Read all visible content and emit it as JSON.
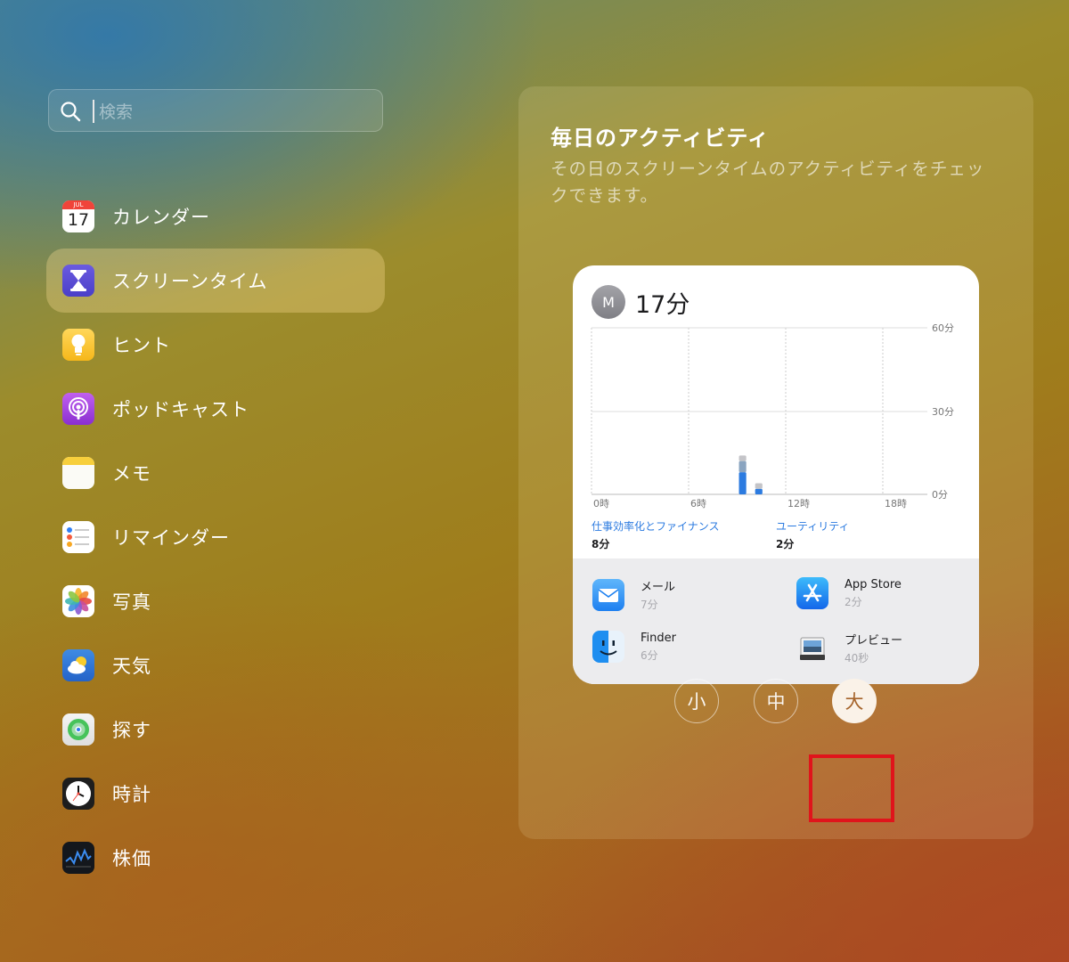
{
  "search": {
    "placeholder": "検索"
  },
  "sidebar": {
    "items": [
      {
        "label": "カレンダー",
        "icon": "calendar-icon",
        "month": "JUL",
        "day": "17"
      },
      {
        "label": "スクリーンタイム",
        "icon": "hourglass-icon",
        "selected": true
      },
      {
        "label": "ヒント",
        "icon": "lightbulb-icon"
      },
      {
        "label": "ポッドキャスト",
        "icon": "podcast-icon"
      },
      {
        "label": "メモ",
        "icon": "notes-icon"
      },
      {
        "label": "リマインダー",
        "icon": "reminders-icon"
      },
      {
        "label": "写真",
        "icon": "photos-icon"
      },
      {
        "label": "天気",
        "icon": "weather-icon"
      },
      {
        "label": "探す",
        "icon": "find-my-icon"
      },
      {
        "label": "時計",
        "icon": "clock-icon"
      },
      {
        "label": "株価",
        "icon": "stocks-icon"
      }
    ]
  },
  "panel": {
    "title": "毎日のアクティビティ",
    "description": "その日のスクリーンタイムのアクティビティをチェックできます。",
    "sizes": [
      "小",
      "中",
      "大"
    ],
    "selected_size": "大"
  },
  "widget": {
    "avatar": "M",
    "total": "17分",
    "categories": [
      {
        "name": "仕事効率化とファイナンス",
        "value": "8分",
        "color": "#2c7be0"
      },
      {
        "name": "ユーティリティ",
        "value": "2分",
        "color": "#2c7be0"
      }
    ],
    "apps": [
      {
        "name": "メール",
        "time": "7分",
        "icon": "mail-icon"
      },
      {
        "name": "App Store",
        "time": "2分",
        "icon": "app-store-icon"
      },
      {
        "name": "Finder",
        "time": "6分",
        "icon": "finder-icon"
      },
      {
        "name": "プレビュー",
        "time": "40秒",
        "icon": "preview-icon"
      }
    ]
  },
  "chart_data": {
    "type": "bar",
    "x_labels": [
      "0時",
      "6時",
      "12時",
      "18時"
    ],
    "y_labels": [
      "60分",
      "30分",
      "0分"
    ],
    "ylim": [
      0,
      60
    ],
    "bars": [
      {
        "hour": 9,
        "segments": [
          {
            "value": 8,
            "color": "#2c7be0"
          },
          {
            "value": 4,
            "color": "#8aa4c0"
          },
          {
            "value": 2,
            "color": "#c4c4c8"
          }
        ]
      },
      {
        "hour": 10,
        "segments": [
          {
            "value": 2,
            "color": "#2c7be0"
          },
          {
            "value": 2,
            "color": "#c4c4c8"
          }
        ]
      }
    ]
  }
}
